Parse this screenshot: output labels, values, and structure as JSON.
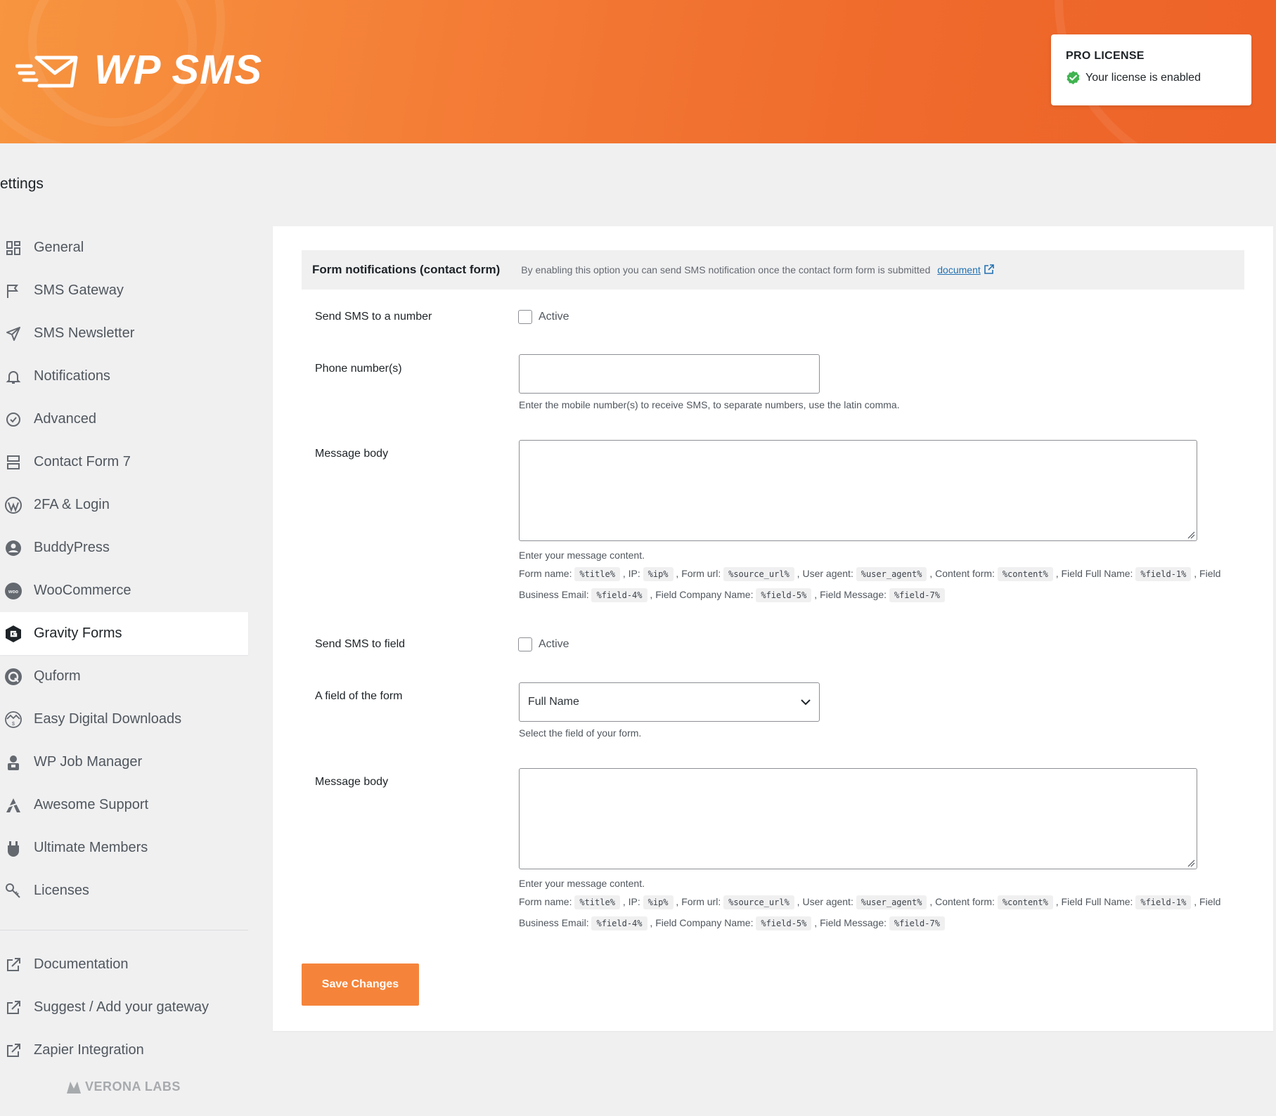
{
  "header": {
    "brand": "WP SMS",
    "license_title": "PRO LICENSE",
    "license_status": "Your license is enabled"
  },
  "page_title": "ettings",
  "sidebar": {
    "items": [
      {
        "label": "General",
        "icon": "grid-icon"
      },
      {
        "label": "SMS Gateway",
        "icon": "flag-icon"
      },
      {
        "label": "SMS Newsletter",
        "icon": "paper-plane-icon"
      },
      {
        "label": "Notifications",
        "icon": "bell-icon"
      },
      {
        "label": "Advanced",
        "icon": "badge-check-icon"
      },
      {
        "label": "Contact Form 7",
        "icon": "form-icon"
      },
      {
        "label": "2FA & Login",
        "icon": "wordpress-icon"
      },
      {
        "label": "BuddyPress",
        "icon": "buddypress-icon"
      },
      {
        "label": "WooCommerce",
        "icon": "woocommerce-icon"
      },
      {
        "label": "Gravity Forms",
        "icon": "gravity-forms-icon",
        "active": true
      },
      {
        "label": "Quform",
        "icon": "quform-icon"
      },
      {
        "label": "Easy Digital Downloads",
        "icon": "edd-icon"
      },
      {
        "label": "WP Job Manager",
        "icon": "job-manager-icon"
      },
      {
        "label": "Awesome Support",
        "icon": "awesome-support-icon"
      },
      {
        "label": "Ultimate Members",
        "icon": "ultimate-member-icon"
      },
      {
        "label": "Licenses",
        "icon": "key-icon"
      }
    ],
    "links": [
      {
        "label": "Documentation",
        "icon": "external-link-icon"
      },
      {
        "label": "Suggest / Add your gateway",
        "icon": "external-link-icon"
      },
      {
        "label": "Zapier Integration",
        "icon": "external-link-icon"
      }
    ],
    "footer_brand": "VERONA LABS"
  },
  "section": {
    "title": "Form notifications (contact form)",
    "description": "By enabling this option you can send SMS notification once the contact form form is submitted",
    "doc_link": "document"
  },
  "form": {
    "send_to_number_label": "Send SMS to a number",
    "active_label": "Active",
    "phone_label": "Phone number(s)",
    "phone_value": "",
    "phone_help": "Enter the mobile number(s) to receive SMS, to separate numbers, use the latin comma.",
    "message_label": "Message body",
    "message_value": "",
    "message_help": "Enter your message content.",
    "send_to_field_label": "Send SMS to field",
    "active_label_2": "Active",
    "field_label": "A field of the form",
    "field_value": "Full Name",
    "field_help": "Select the field of your form.",
    "message_label_2": "Message body",
    "message_help_2": "Enter your message content.",
    "variables": {
      "form_name": "Form name:",
      "form_name_code": "%title%",
      "ip": "IP:",
      "ip_code": "%ip%",
      "form_url": "Form url:",
      "form_url_code": "%source_url%",
      "user_agent": "User agent:",
      "user_agent_code": "%user_agent%",
      "content_form": "Content form:",
      "content_form_code": "%content%",
      "full_name": "Field Full Name:",
      "full_name_code": "%field-1%",
      "business_email": "Field Business Email:",
      "business_email_code": "%field-4%",
      "company_name": "Field Company Name:",
      "company_name_code": "%field-5%",
      "field_message": "Field Message:",
      "field_message_code": "%field-7%"
    }
  },
  "save_button": "Save Changes",
  "colors": {
    "accent": "#f5843a",
    "header_start": "#f79540",
    "header_end": "#ee6328",
    "link": "#2271b1",
    "success": "#3fb34f"
  }
}
